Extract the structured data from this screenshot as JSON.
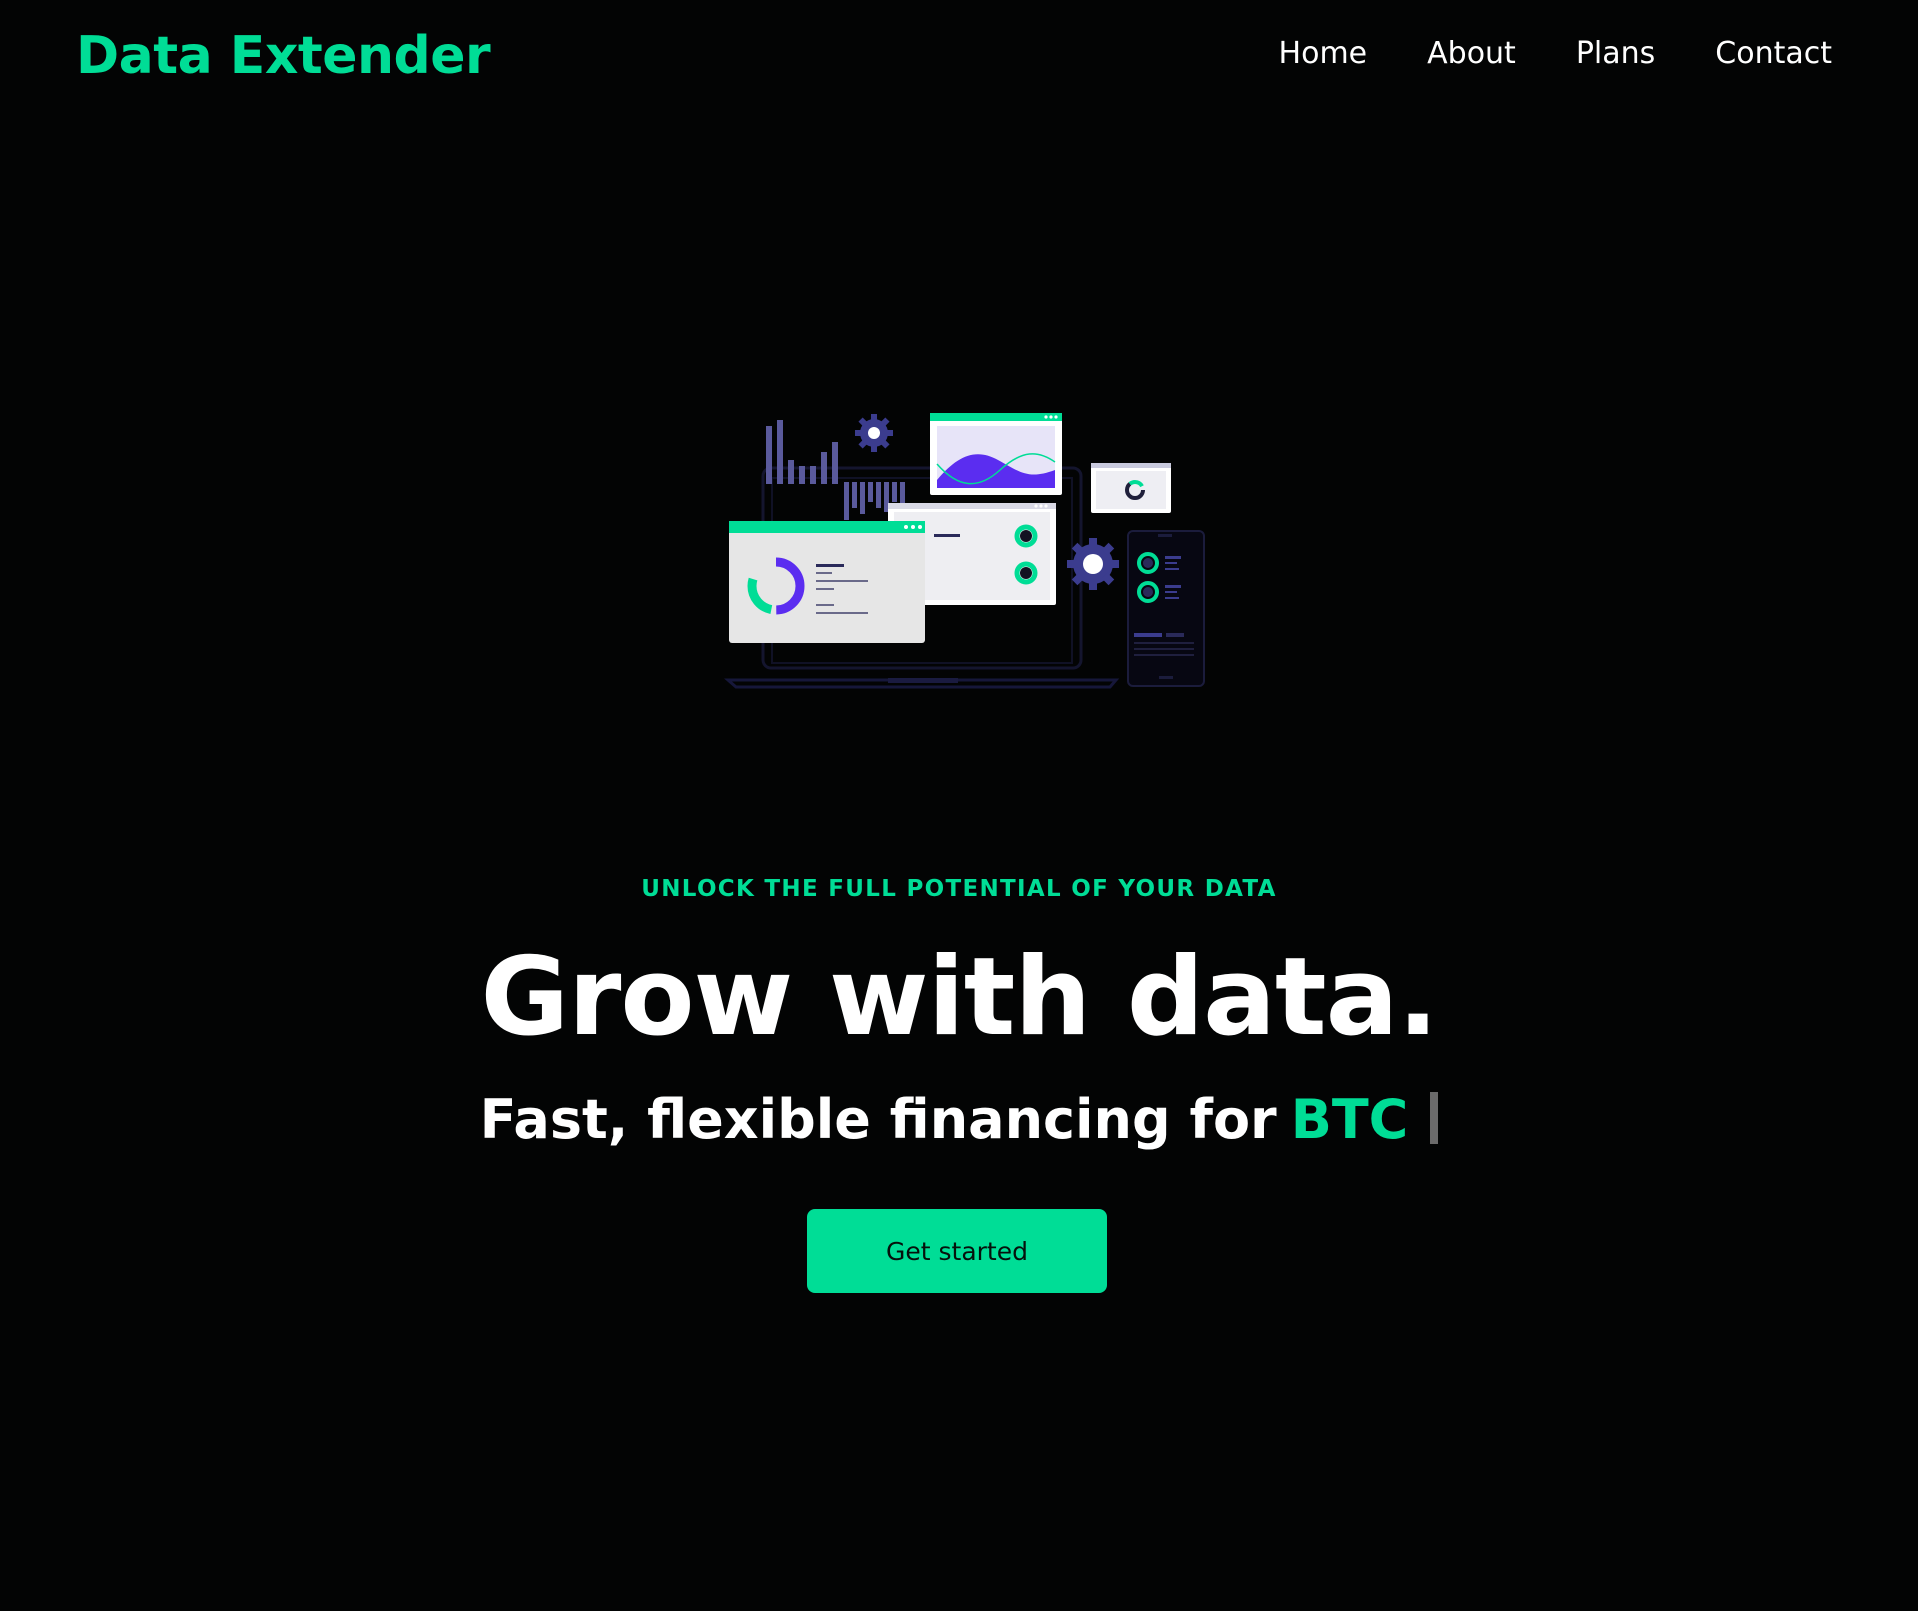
{
  "header": {
    "brand": "Data Extender",
    "nav": [
      {
        "label": "Home"
      },
      {
        "label": "About"
      },
      {
        "label": "Plans"
      },
      {
        "label": "Contact"
      }
    ]
  },
  "hero": {
    "eyebrow": "UNLOCK THE FULL POTENTIAL OF YOUR DATA",
    "headline": "Grow with data.",
    "subline_prefix": "Fast, flexible financing for",
    "subline_word": "BTC",
    "cta_label": "Get started",
    "illustration": "dashboard-analytics-illustration"
  },
  "colors": {
    "background": "#030404",
    "accent": "#00dd96",
    "text": "#ffffff",
    "illustration_purple": "#5b2df0",
    "illustration_slate": "#5a5a9c"
  }
}
